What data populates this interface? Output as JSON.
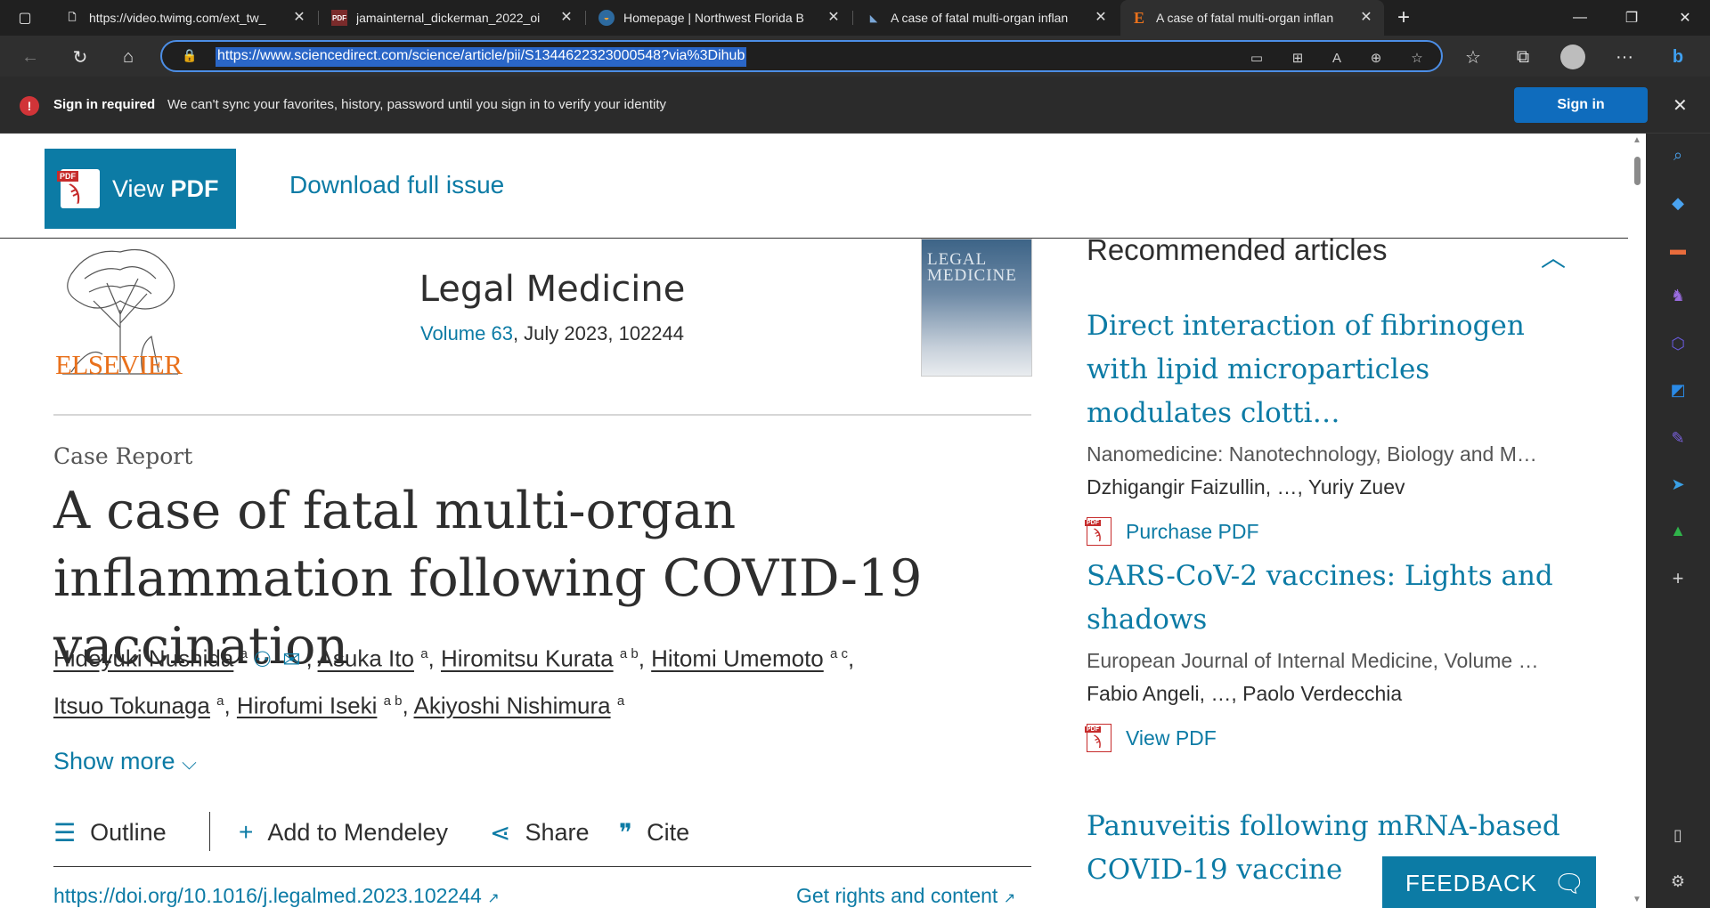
{
  "tabs": [
    {
      "title": "https://video.twimg.com/ext_tw_",
      "icon": "document-icon"
    },
    {
      "title": "jamainternal_dickerman_2022_oi",
      "icon": "pdf-icon"
    },
    {
      "title": "Homepage | Northwest Florida B",
      "icon": "globe-icon"
    },
    {
      "title": "A case of fatal multi-organ inflan",
      "icon": "sd-icon"
    },
    {
      "title": "A case of fatal multi-organ inflan",
      "icon": "elsevier-e-icon"
    }
  ],
  "address": {
    "url": "https://www.sciencedirect.com/science/article/pii/S1344622323000548?via%3Dihub"
  },
  "infobar": {
    "strong": "Sign in required",
    "message": "We can't sync your favorites, history, password until you sign in to verify your identity",
    "button": "Sign in"
  },
  "toolbar": {
    "view_pdf_prefix": "View ",
    "view_pdf_strong": "PDF",
    "download_issue": "Download full issue"
  },
  "journal": {
    "publisher": "ELSEVIER",
    "title": "Legal Medicine",
    "volume_link": "Volume 63",
    "volume_rest": ", July 2023, 102244",
    "cover_text": "LEGAL MEDICINE"
  },
  "article": {
    "type": "Case Report",
    "title": "A case of fatal multi-organ inflammation following COVID-19 vaccination",
    "authors": [
      {
        "name": "Hideyuki Nushida",
        "sup": "a"
      },
      {
        "name": "Asuka Ito",
        "sup": "a"
      },
      {
        "name": "Hiromitsu Kurata",
        "sup": "a b"
      },
      {
        "name": "Hitomi Umemoto",
        "sup": "a c"
      },
      {
        "name": "Itsuo Tokunaga",
        "sup": "a"
      },
      {
        "name": "Hirofumi Iseki",
        "sup": "a b"
      },
      {
        "name": "Akiyoshi Nishimura",
        "sup": "a"
      }
    ],
    "show_more": "Show more",
    "tools": {
      "outline": "Outline",
      "mendeley": "Add to Mendeley",
      "share": "Share",
      "cite": "Cite"
    },
    "doi": "https://doi.org/10.1016/j.legalmed.2023.102244",
    "rights": "Get rights and content"
  },
  "recommended": {
    "heading": "Recommended articles",
    "items": [
      {
        "title": "Direct interaction of fibrinogen with lipid microparticles modulates clotti…",
        "journal": "Nanomedicine: Nanotechnology, Biology and M…",
        "authors": "Dzhigangir Faizullin, …, Yuriy Zuev",
        "link": "Purchase PDF"
      },
      {
        "title": "SARS-CoV-2 vaccines: Lights and shadows",
        "journal": "European Journal of Internal Medicine, Volume …",
        "authors": "Fabio Angeli, …, Paolo Verdecchia",
        "link": "View PDF"
      },
      {
        "title": "Panuveitis following mRNA-based COVID-19 vaccine"
      }
    ]
  },
  "feedback": {
    "label": "FEEDBACK"
  },
  "colors": {
    "brand": "#0c7ba5",
    "elsevier_orange": "#e9711c",
    "signin_blue": "#0f6cbd"
  }
}
